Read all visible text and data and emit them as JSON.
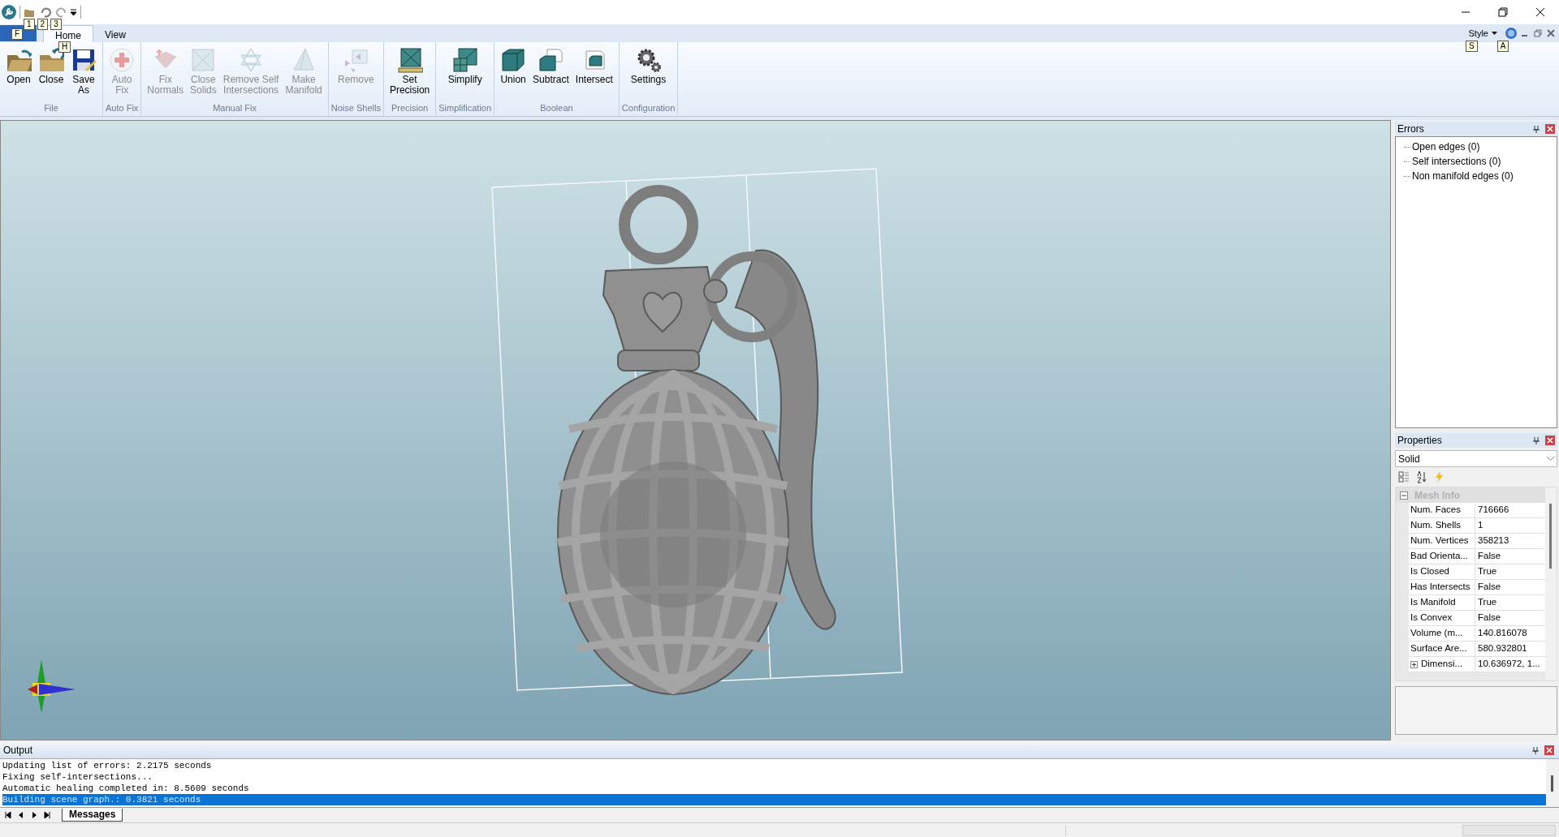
{
  "quick_access": {
    "key_tips": [
      "1",
      "2",
      "3"
    ]
  },
  "ribbon": {
    "file_key_tip": "F",
    "tabs": [
      {
        "label": "Home",
        "selected": true,
        "key_tip": "H"
      },
      {
        "label": "View",
        "selected": false
      }
    ],
    "style_menu": "Style",
    "right_key_tips": [
      "S",
      "A"
    ],
    "groups": [
      {
        "label": "File",
        "buttons": [
          {
            "lines": [
              "Open"
            ],
            "kind": "open",
            "disabled": false
          },
          {
            "lines": [
              "Close"
            ],
            "kind": "close",
            "disabled": false
          },
          {
            "lines": [
              "Save",
              "As"
            ],
            "kind": "save",
            "disabled": false
          }
        ]
      },
      {
        "label": "Auto Fix",
        "buttons": [
          {
            "lines": [
              "Auto",
              "Fix"
            ],
            "kind": "autofix",
            "disabled": true
          }
        ]
      },
      {
        "label": "Manual Fix",
        "buttons": [
          {
            "lines": [
              "Fix",
              "Normals"
            ],
            "kind": "normals",
            "disabled": true
          },
          {
            "lines": [
              "Close",
              "Solids"
            ],
            "kind": "solids",
            "disabled": true
          },
          {
            "lines": [
              "Remove Self",
              "Intersections"
            ],
            "kind": "star",
            "disabled": true
          },
          {
            "lines": [
              "Make",
              "Manifold"
            ],
            "kind": "manifold",
            "disabled": true
          }
        ]
      },
      {
        "label": "Noise Shells",
        "buttons": [
          {
            "lines": [
              "Remove"
            ],
            "kind": "remove",
            "disabled": true
          }
        ]
      },
      {
        "label": "Precision",
        "buttons": [
          {
            "lines": [
              "Set",
              "Precision"
            ],
            "kind": "precision",
            "disabled": false
          }
        ]
      },
      {
        "label": "Simplification",
        "buttons": [
          {
            "lines": [
              "Simplify"
            ],
            "kind": "simplify",
            "disabled": false
          }
        ]
      },
      {
        "label": "Boolean",
        "buttons": [
          {
            "lines": [
              "Union"
            ],
            "kind": "union",
            "disabled": false
          },
          {
            "lines": [
              "Subtract"
            ],
            "kind": "subtract",
            "disabled": false
          },
          {
            "lines": [
              "Intersect"
            ],
            "kind": "intersect",
            "disabled": false
          }
        ]
      },
      {
        "label": "Configuration",
        "buttons": [
          {
            "lines": [
              "Settings"
            ],
            "kind": "settings",
            "disabled": false
          }
        ]
      }
    ]
  },
  "errors_panel": {
    "title": "Errors",
    "items": [
      "Open edges (0)",
      "Self intersections (0)",
      "Non manifold edges (0)"
    ]
  },
  "properties_panel": {
    "title": "Properties",
    "object": "Solid",
    "category": {
      "label": "Mesh Info",
      "expanded": true
    },
    "rows": [
      {
        "name": "Num. Faces",
        "value": "716666"
      },
      {
        "name": "Num. Shells",
        "value": "1"
      },
      {
        "name": "Num. Vertices",
        "value": "358213"
      },
      {
        "name": "Bad Orienta...",
        "value": "False"
      },
      {
        "name": "Is Closed",
        "value": "True"
      },
      {
        "name": "Has Intersects",
        "value": "False"
      },
      {
        "name": "Is Manifold",
        "value": "True"
      },
      {
        "name": "Is Convex",
        "value": "False"
      },
      {
        "name": "Volume (m...",
        "value": "140.816078"
      },
      {
        "name": "Surface Are...",
        "value": "580.932801"
      },
      {
        "name": "Dimensi...",
        "value": "10.636972, 1...",
        "expanded": false
      }
    ]
  },
  "output_panel": {
    "title": "Output",
    "lines": [
      {
        "text": "Updating list of errors: 2.2175 seconds",
        "selected": false
      },
      {
        "text": "Fixing self-intersections...",
        "selected": false
      },
      {
        "text": "Automatic healing completed in: 8.5609 seconds",
        "selected": false
      },
      {
        "text": "Building scene graph.: 0.3821 seconds",
        "selected": true
      }
    ],
    "tabs": [
      {
        "label": "Messages",
        "selected": true
      }
    ]
  }
}
